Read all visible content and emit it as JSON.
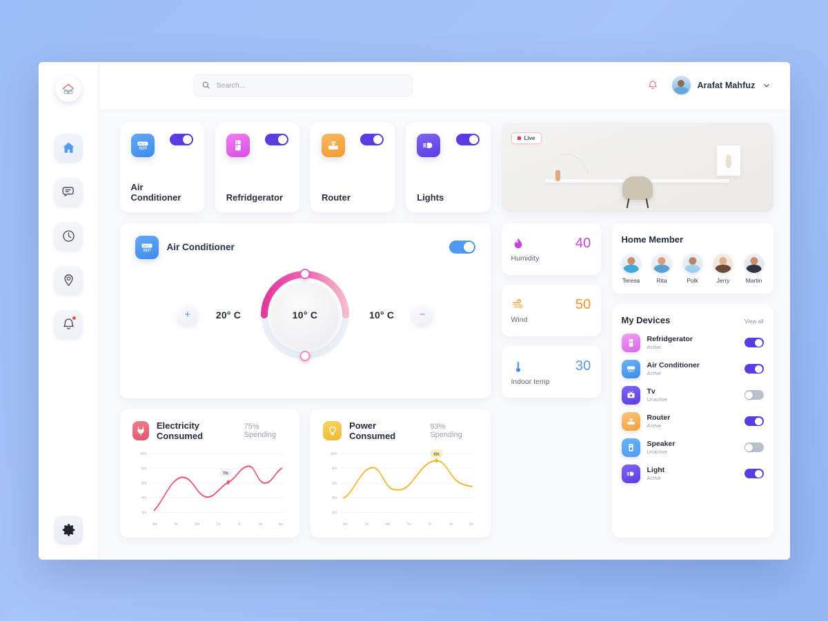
{
  "app": {
    "background_color": "#9dbdf6",
    "accent_purple": "#5b3ce0"
  },
  "sidebar": {
    "logo_name": "home-logo",
    "items": [
      {
        "name": "home",
        "icon": "home-icon",
        "active": true,
        "badge": false
      },
      {
        "name": "messages",
        "icon": "chat-icon",
        "active": false,
        "badge": false
      },
      {
        "name": "history",
        "icon": "clock-icon",
        "active": false,
        "badge": false
      },
      {
        "name": "location",
        "icon": "location-icon",
        "active": false,
        "badge": false
      },
      {
        "name": "notifications",
        "icon": "bell-icon",
        "active": false,
        "badge": true
      }
    ],
    "bottom_item": {
      "name": "settings",
      "icon": "gear-icon"
    }
  },
  "header": {
    "search": {
      "placeholder": "Search...",
      "value": "",
      "icon": "search-icon"
    },
    "notification_icon": "bell-icon",
    "user": {
      "name": "Arafat Mahfuz",
      "avatar": "user-avatar",
      "caret": "chevron-down-icon"
    }
  },
  "quick_devices": [
    {
      "label": "Air Conditioner",
      "icon": "air-conditioner-icon",
      "color": "#4f9bf0",
      "on": true
    },
    {
      "label": "Refridgerator",
      "icon": "refrigerator-icon",
      "color": "#e364ea",
      "on": true
    },
    {
      "label": "Router",
      "icon": "router-icon",
      "color": "#f5a33f",
      "on": true
    },
    {
      "label": "Lights",
      "icon": "light-icon",
      "color": "#6c4ce8",
      "on": true
    }
  ],
  "live_camera": {
    "badge_label": "Live",
    "live_dot_color": "#e8343f"
  },
  "ac_panel": {
    "title": "Air Conditioner",
    "icon": "air-conditioner-icon",
    "on": true,
    "increase_label": "+",
    "decrease_label": "−",
    "left_temp": "20° C",
    "center_temp": "10° C",
    "right_temp": "10° C",
    "gauge_start_color": "#e3409e",
    "gauge_end_color": "#f6b8c9"
  },
  "sensors": [
    {
      "label": "Humidity",
      "value": "40",
      "icon": "water-drop-icon",
      "color": "#c345d8"
    },
    {
      "label": "Wind",
      "value": "50",
      "icon": "wind-icon",
      "color": "#f5a33f"
    },
    {
      "label": "Indoor temp",
      "value": "30",
      "icon": "thermometer-icon",
      "color": "#6ba4e8"
    }
  ],
  "home_member": {
    "title": "Home Member",
    "members": [
      {
        "name": "Teresa",
        "skin": "#c98f6a",
        "shirt": "#3fa8d8"
      },
      {
        "name": "Rita",
        "skin": "#d4a07a",
        "shirt": "#5b9fd0"
      },
      {
        "name": "Polk",
        "skin": "#b8856a",
        "shirt": "#9dd0ef"
      },
      {
        "name": "Jerry",
        "skin": "#e0b08c",
        "shirt": "#6b4a3a"
      },
      {
        "name": "Martin",
        "skin": "#c58f68",
        "shirt": "#2f3540"
      }
    ]
  },
  "my_devices": {
    "title": "My Devices",
    "view_all_label": "View all",
    "items": [
      {
        "name": "Refridgerator",
        "status": "Active",
        "icon": "refrigerator-icon",
        "color": "#e364ea",
        "on": true
      },
      {
        "name": "Air Conditioner",
        "status": "Active",
        "icon": "air-conditioner-icon",
        "color": "#4f9bf0",
        "on": true
      },
      {
        "name": "Tv",
        "status": "Unactive",
        "icon": "tv-icon",
        "color": "#6c4ce8",
        "on": false
      },
      {
        "name": "Router",
        "status": "Active",
        "icon": "router-icon",
        "color": "#f5a33f",
        "on": true
      },
      {
        "name": "Speaker",
        "status": "Unactive",
        "icon": "speaker-icon",
        "color": "#4f9bf0",
        "on": false
      },
      {
        "name": "Light",
        "status": "Active",
        "icon": "light-icon",
        "color": "#6c4ce8",
        "on": true
      }
    ]
  },
  "chart_data": [
    {
      "type": "line",
      "title": "Electricity Consumed",
      "subtitle": "75% Spending",
      "icon": "electric-plug-icon",
      "icon_color": "#e85a6e",
      "line_color": "#e8566e",
      "xlabel": "",
      "ylabel": "",
      "categories": [
        "Mon",
        "Tue",
        "Wed",
        "Thu",
        "Fri",
        "Sat",
        "Sun"
      ],
      "tick_labels": [
        "100%",
        "80%",
        "60%",
        "40%",
        "20%"
      ],
      "ylim": [
        20,
        100
      ],
      "values": [
        27,
        72,
        77,
        50,
        66,
        88,
        78
      ],
      "annotation": {
        "label": "75%",
        "x_category": "Fri",
        "value": 66
      },
      "grid": true,
      "legend": "none"
    },
    {
      "type": "line",
      "title": "Power Consumed",
      "subtitle": "93% Spending",
      "icon": "bulb-icon",
      "icon_color": "#f0c33c",
      "line_color": "#eeb92e",
      "xlabel": "",
      "ylabel": "",
      "categories": [
        "Mon",
        "Tue",
        "Wed",
        "Thu",
        "Fri",
        "Sat",
        "Sun"
      ],
      "tick_labels": [
        "100%",
        "80%",
        "60%",
        "40%",
        "20%"
      ],
      "ylim": [
        20,
        100
      ],
      "values": [
        44,
        82,
        57,
        55,
        84,
        93,
        66
      ],
      "annotation": {
        "label": "93%",
        "x_category": "Sat",
        "value": 93
      },
      "grid": true,
      "legend": "none"
    }
  ]
}
